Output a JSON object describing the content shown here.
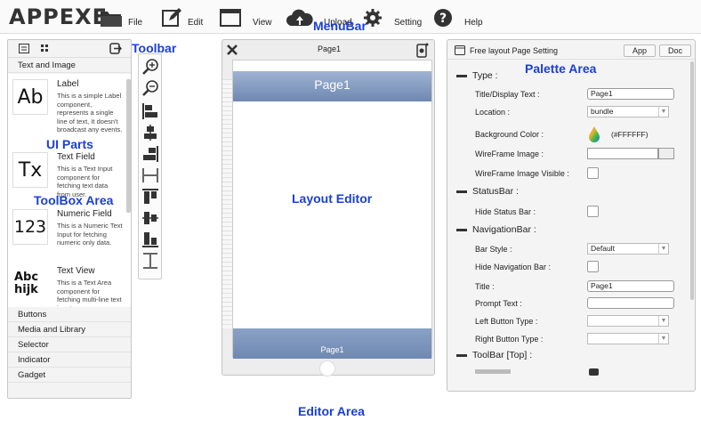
{
  "menubar": {
    "logo": "APPEXE",
    "items": [
      {
        "label": "File",
        "icon": "folder-icon"
      },
      {
        "label": "Edit",
        "icon": "pencil-icon"
      },
      {
        "label": "View",
        "icon": "window-icon"
      },
      {
        "label": "Upload",
        "icon": "cloud-upload-icon"
      },
      {
        "label": "Setting",
        "icon": "gear-icon"
      },
      {
        "label": "Help",
        "icon": "question-icon"
      }
    ]
  },
  "annotations": {
    "menubar": "MenuBar",
    "toolbar": "Toolbar",
    "ui_parts": "UI Parts",
    "toolbox_area": "ToolBox Area",
    "layout_editor": "Layout Editor",
    "palette_area": "Palette Area",
    "editor_area": "Editor Area"
  },
  "toolbox": {
    "sections_top": [
      "Text and Image"
    ],
    "parts": [
      {
        "icon_text": "Ab",
        "name": "Label",
        "desc": "This is a simple Label component, represents a single line of text, It doesn't broadcast any events."
      },
      {
        "icon_text": "Tx",
        "name": "Text Field",
        "desc": "This is a Text Input component for fetching text data from user."
      },
      {
        "icon_text": "123",
        "name": "Numeric Field",
        "desc": "This is a Numeric Text Input for fetching numeric only data."
      },
      {
        "icon_text": "Abc hijk",
        "name": "Text View",
        "desc": "This is a Text Area component for fetching multi-line text input."
      }
    ],
    "sections_bottom": [
      "Buttons",
      "Media and Library",
      "Selector",
      "Indicator",
      "Gadget"
    ]
  },
  "editor": {
    "title": "Page1",
    "nav_title": "Page1",
    "toolbar_title": "Page1"
  },
  "palette": {
    "header_title": "Free layout Page Setting",
    "btn_app": "App",
    "btn_doc": "Doc",
    "sections": {
      "type": "Type :",
      "statusbar": "StatusBar :",
      "navigationbar": "NavigationBar :",
      "toolbar_top": "ToolBar [Top] :"
    },
    "fields": {
      "title_display_label": "Title/Display Text :",
      "title_display_value": "Page1",
      "location_label": "Location :",
      "location_value": "bundle",
      "bg_color_label": "Background Color :",
      "bg_color_value": "(#FFFFFF)",
      "wireframe_image_label": "WireFrame Image :",
      "wireframe_visible_label": "WireFrame Image Visible :",
      "hide_status_label": "Hide Status Bar :",
      "bar_style_label": "Bar Style :",
      "bar_style_value": "Default",
      "hide_nav_label": "Hide Navigation Bar :",
      "title_label": "Title :",
      "title_value": "Page1",
      "prompt_label": "Prompt Text :",
      "left_btn_label": "Left Button Type :",
      "right_btn_label": "Right Button Type :"
    }
  }
}
